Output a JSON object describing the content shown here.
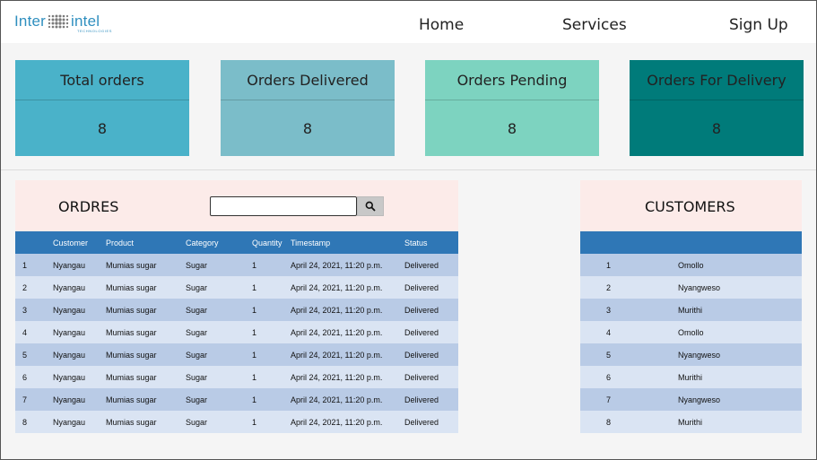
{
  "header": {
    "logo": {
      "left": "Inter",
      "right": "intel",
      "sub": "TECHNOLOGIES"
    },
    "nav": [
      "Home",
      "Services",
      "Sign Up"
    ]
  },
  "cards": [
    {
      "title": "Total orders",
      "value": "8",
      "color": "#4ab2c9"
    },
    {
      "title": "Orders Delivered",
      "value": "8",
      "color": "#7bbdc9"
    },
    {
      "title": "Orders Pending",
      "value": "8",
      "color": "#7dd3c0"
    },
    {
      "title": "Orders For Delivery",
      "value": "8",
      "color": "#007b7a"
    }
  ],
  "orders": {
    "title": "ORDRES",
    "search": {
      "value": "",
      "placeholder": ""
    },
    "columns": [
      "",
      "Customer",
      "Product",
      "Category",
      "Quantity",
      "Timestamp",
      "Status"
    ],
    "rows": [
      [
        "1",
        "Nyangau",
        "Mumias sugar",
        "Sugar",
        "1",
        "April 24, 2021, 11:20 p.m.",
        "Delivered"
      ],
      [
        "2",
        "Nyangau",
        "Mumias sugar",
        "Sugar",
        "1",
        "April 24, 2021, 11:20 p.m.",
        "Delivered"
      ],
      [
        "3",
        "Nyangau",
        "Mumias sugar",
        "Sugar",
        "1",
        "April 24, 2021, 11:20 p.m.",
        "Delivered"
      ],
      [
        "4",
        "Nyangau",
        "Mumias sugar",
        "Sugar",
        "1",
        "April 24, 2021, 11:20 p.m.",
        "Delivered"
      ],
      [
        "5",
        "Nyangau",
        "Mumias sugar",
        "Sugar",
        "1",
        "April 24, 2021, 11:20 p.m.",
        "Delivered"
      ],
      [
        "6",
        "Nyangau",
        "Mumias sugar",
        "Sugar",
        "1",
        "April 24, 2021, 11:20 p.m.",
        "Delivered"
      ],
      [
        "7",
        "Nyangau",
        "Mumias sugar",
        "Sugar",
        "1",
        "April 24, 2021, 11:20 p.m.",
        "Delivered"
      ],
      [
        "8",
        "Nyangau",
        "Mumias sugar",
        "Sugar",
        "1",
        "April 24, 2021, 11:20 p.m.",
        "Delivered"
      ]
    ]
  },
  "customers": {
    "title": "CUSTOMERS",
    "rows": [
      [
        "1",
        "Omollo"
      ],
      [
        "2",
        "Nyangweso"
      ],
      [
        "3",
        "Murithi"
      ],
      [
        "4",
        "Omollo"
      ],
      [
        "5",
        "Nyangweso"
      ],
      [
        "6",
        "Murithi"
      ],
      [
        "7",
        "Nyangweso"
      ],
      [
        "8",
        "Murithi"
      ]
    ]
  },
  "colors": {
    "brand": "#2f8fbf",
    "table_header": "#2f77b6",
    "row_odd": "#b9cbe6",
    "row_even": "#dae4f3",
    "panel_head": "#fcebe9"
  },
  "icons": {
    "search": "search-icon"
  }
}
